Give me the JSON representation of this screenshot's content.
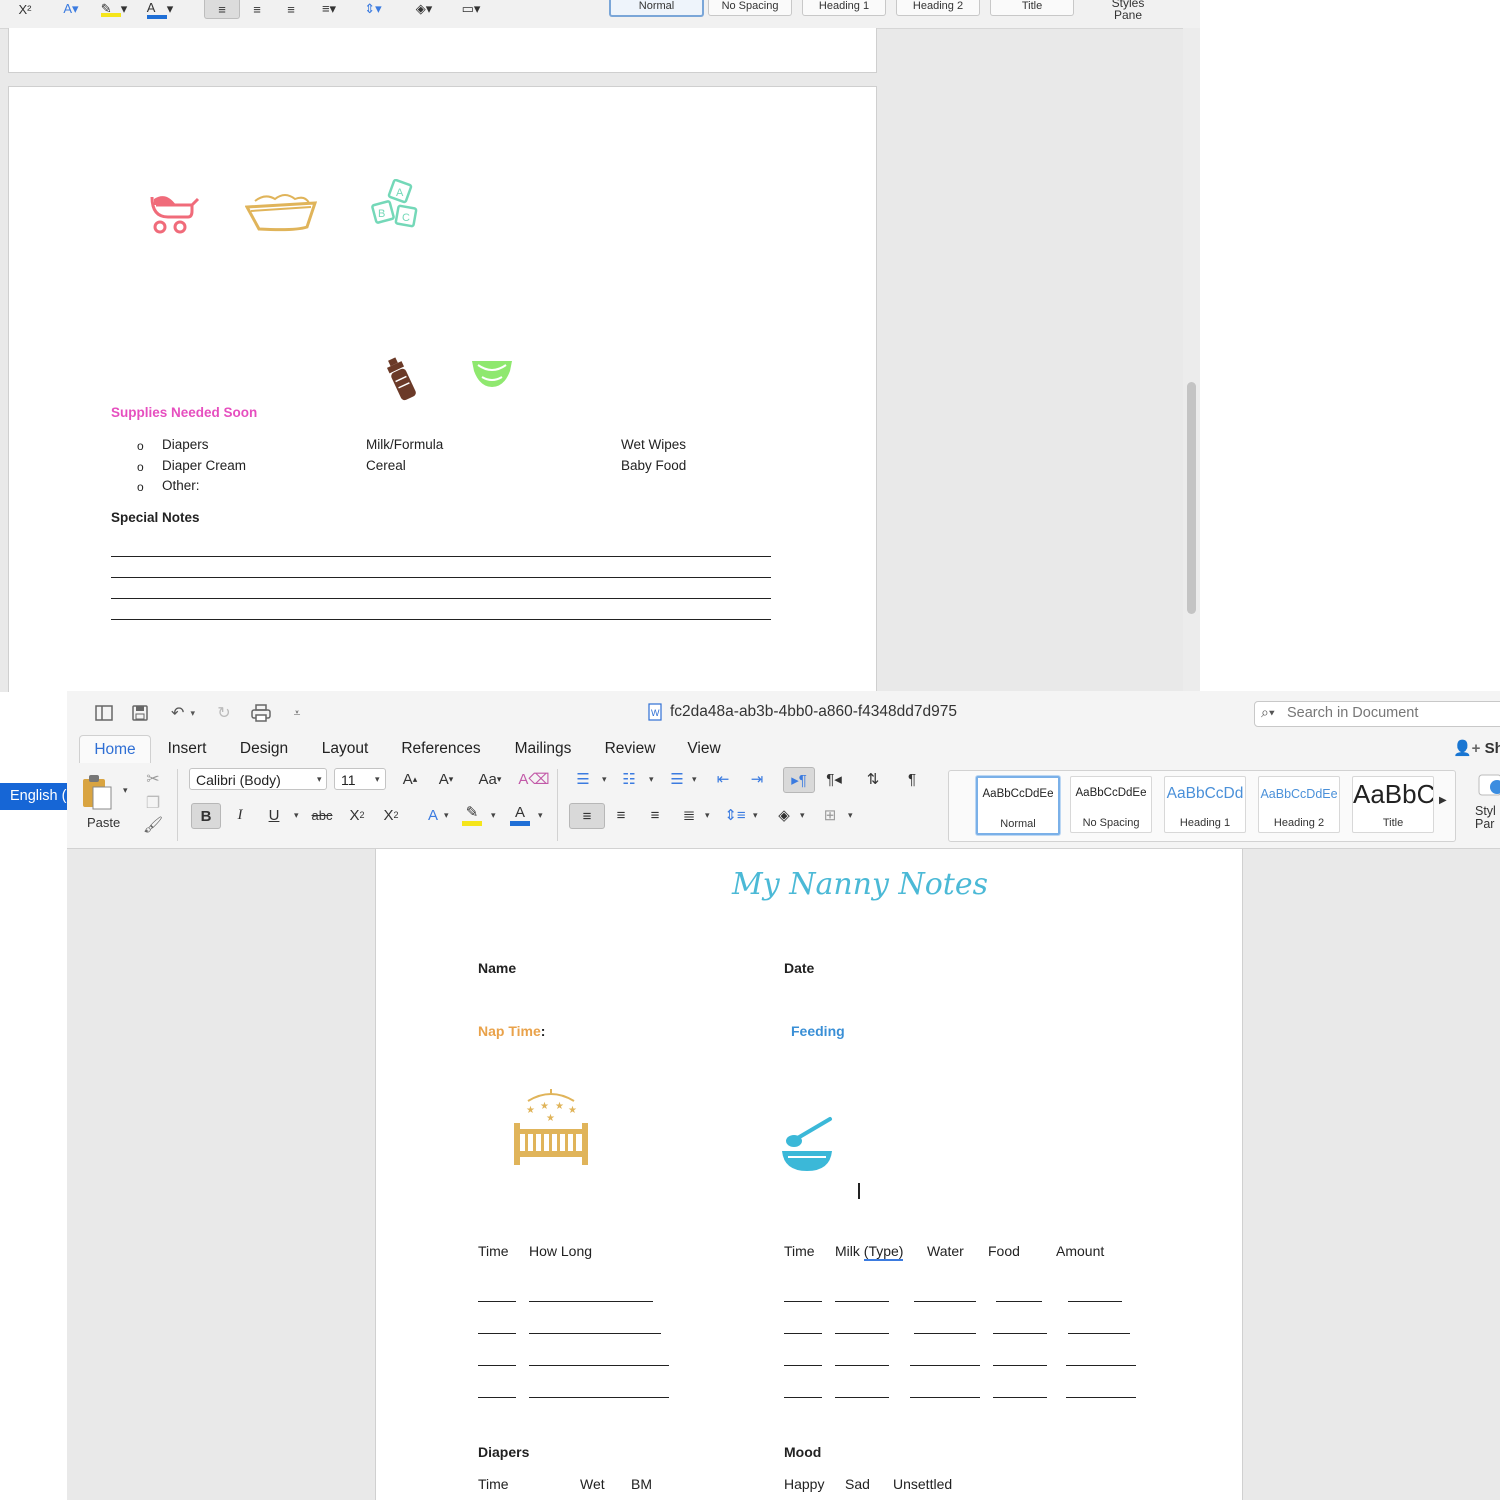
{
  "back_window": {
    "ribbon": {
      "styles": [
        "Normal",
        "No Spacing",
        "Heading 1",
        "Heading 2",
        "Title"
      ],
      "styles_pane": "Styles Pane"
    },
    "page": {
      "supplies_heading": "Supplies Needed Soon",
      "supplies_col1": [
        "Diapers",
        "Diaper Cream",
        "Other:"
      ],
      "supplies_col2": [
        "Milk/Formula",
        "Cereal"
      ],
      "supplies_col3": [
        "Wet Wipes",
        "Baby Food"
      ],
      "special_notes": "Special Notes",
      "icons": [
        "stroller-icon",
        "baby-bathtub-icon",
        "abc-blocks-icon",
        "baby-bottle-icon",
        "diaper-icon"
      ]
    }
  },
  "front_window": {
    "title": "fc2da48a-ab3b-4bb0-a860-f4348dd7d975",
    "search_placeholder": "Search in Document",
    "share_label": "Sha",
    "tabs": [
      "Home",
      "Insert",
      "Design",
      "Layout",
      "References",
      "Mailings",
      "Review",
      "View"
    ],
    "active_tab": "Home",
    "paste_label": "Paste",
    "font_name": "Calibri (Body)",
    "font_size": "11",
    "styles": [
      {
        "sample": "AaBbCcDdEe",
        "name": "Normal"
      },
      {
        "sample": "AaBbCcDdEe",
        "name": "No Spacing"
      },
      {
        "sample": "AaBbCcDd",
        "name": "Heading 1"
      },
      {
        "sample": "AaBbCcDdEe",
        "name": "Heading 2"
      },
      {
        "sample": "AaBbC",
        "name": "Title"
      }
    ],
    "styles_pane": "Styles Pane",
    "styles_pane_visible": "Styl Par",
    "colors": {
      "accent": "#2f6fd4",
      "highlight": "#f5e51a",
      "font_color": "#1f6fd6",
      "heading1": "#4a90d9"
    }
  },
  "document": {
    "title": "My Nanny Notes",
    "name_label": "Name",
    "date_label": "Date",
    "nap_time": "Nap Time",
    "nap_colon": ":",
    "feeding": "Feeding",
    "nap_headers": [
      "Time",
      "How Long"
    ],
    "feeding_headers": [
      "Time",
      "Milk",
      "(Type)",
      "Water",
      "Food",
      "Amount"
    ],
    "diapers": "Diapers",
    "mood": "Mood",
    "diaper_headers": [
      "Time",
      "Wet",
      "BM"
    ],
    "mood_options": [
      "Happy",
      "Sad",
      "Unsettled"
    ],
    "colors": {
      "title": "#4bb9d6",
      "nap": "#e9a24a",
      "feeding": "#3a8fd6",
      "supplies": "#e64fbf"
    }
  },
  "language_badge": "English ("
}
